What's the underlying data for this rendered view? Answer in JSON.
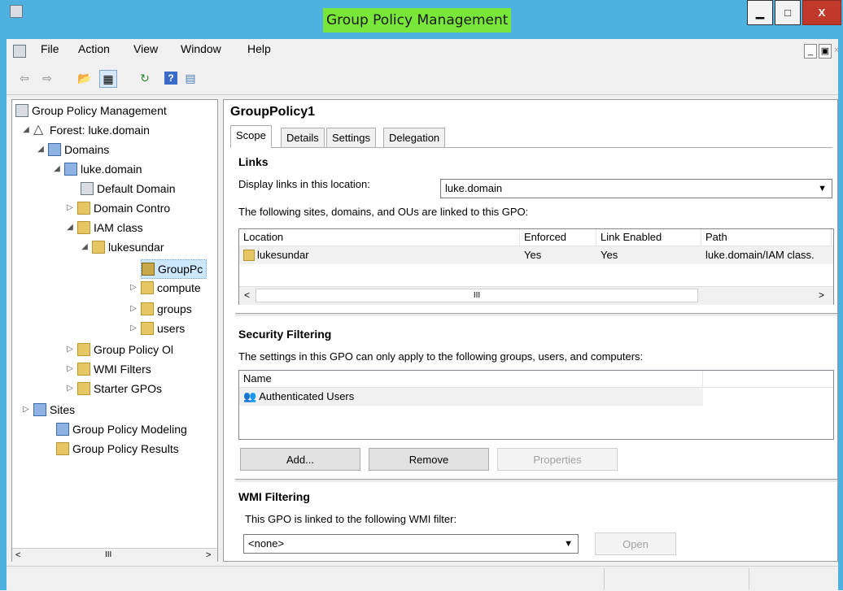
{
  "window": {
    "title": "Group Policy Management",
    "minimize": "▁",
    "maximize": "□",
    "close": "X"
  },
  "menu": [
    "File",
    "Action",
    "View",
    "Window",
    "Help"
  ],
  "tree": {
    "root": "Group Policy Management",
    "forest": "Forest: luke.domain",
    "domains": "Domains",
    "domain": "luke.domain",
    "default_domain": "Default Domain",
    "domain_controllers": "Domain Contro",
    "iam_class": "IAM class",
    "lukesundar": "lukesundar",
    "grouppolicy": "GroupPc",
    "computers": "compute",
    "groups": "groups",
    "users": "users",
    "gpo": "Group Policy Ol",
    "wmi": "WMI Filters",
    "starter": "Starter GPOs",
    "sites": "Sites",
    "modeling": "Group Policy Modeling",
    "results": "Group Policy Results",
    "scroll_mid": "III"
  },
  "details": {
    "title": "GroupPolicy1",
    "tabs": [
      "Scope",
      "Details",
      "Settings",
      "Delegation"
    ],
    "links": {
      "heading": "Links",
      "display_label": "Display links in this location:",
      "location_value": "luke.domain",
      "linked_label": "The following sites, domains, and OUs are linked to this GPO:",
      "columns": [
        "Location",
        "Enforced",
        "Link Enabled",
        "Path"
      ],
      "rows": [
        {
          "location": "lukesundar",
          "enforced": "Yes",
          "link_enabled": "Yes",
          "path": "luke.domain/IAM class."
        }
      ],
      "scroll_mid": "III"
    },
    "security": {
      "heading": "Security Filtering",
      "desc": "The settings in this GPO can only apply to the following groups, users, and computers:",
      "columns": [
        "Name"
      ],
      "rows": [
        "Authenticated Users"
      ],
      "buttons": {
        "add": "Add...",
        "remove": "Remove",
        "properties": "Properties"
      }
    },
    "wmi": {
      "heading": "WMI Filtering",
      "desc": "This GPO is linked to the following WMI filter:",
      "value": "<none>",
      "open": "Open"
    }
  },
  "colors": {
    "titlebar": "#4fb1e0",
    "title_highlight": "#79e63a"
  }
}
